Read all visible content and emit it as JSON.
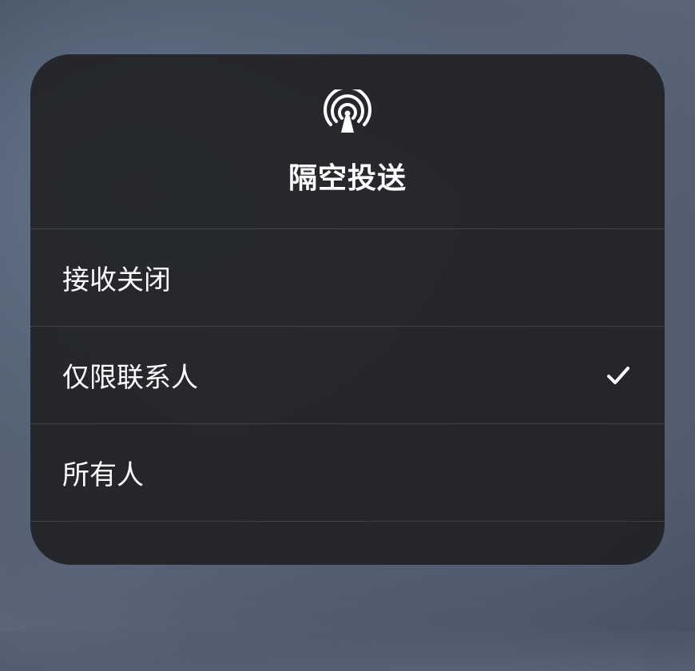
{
  "panel": {
    "title": "隔空投送",
    "options": [
      {
        "label": "接收关闭",
        "selected": false
      },
      {
        "label": "仅限联系人",
        "selected": true
      },
      {
        "label": "所有人",
        "selected": false
      }
    ]
  }
}
